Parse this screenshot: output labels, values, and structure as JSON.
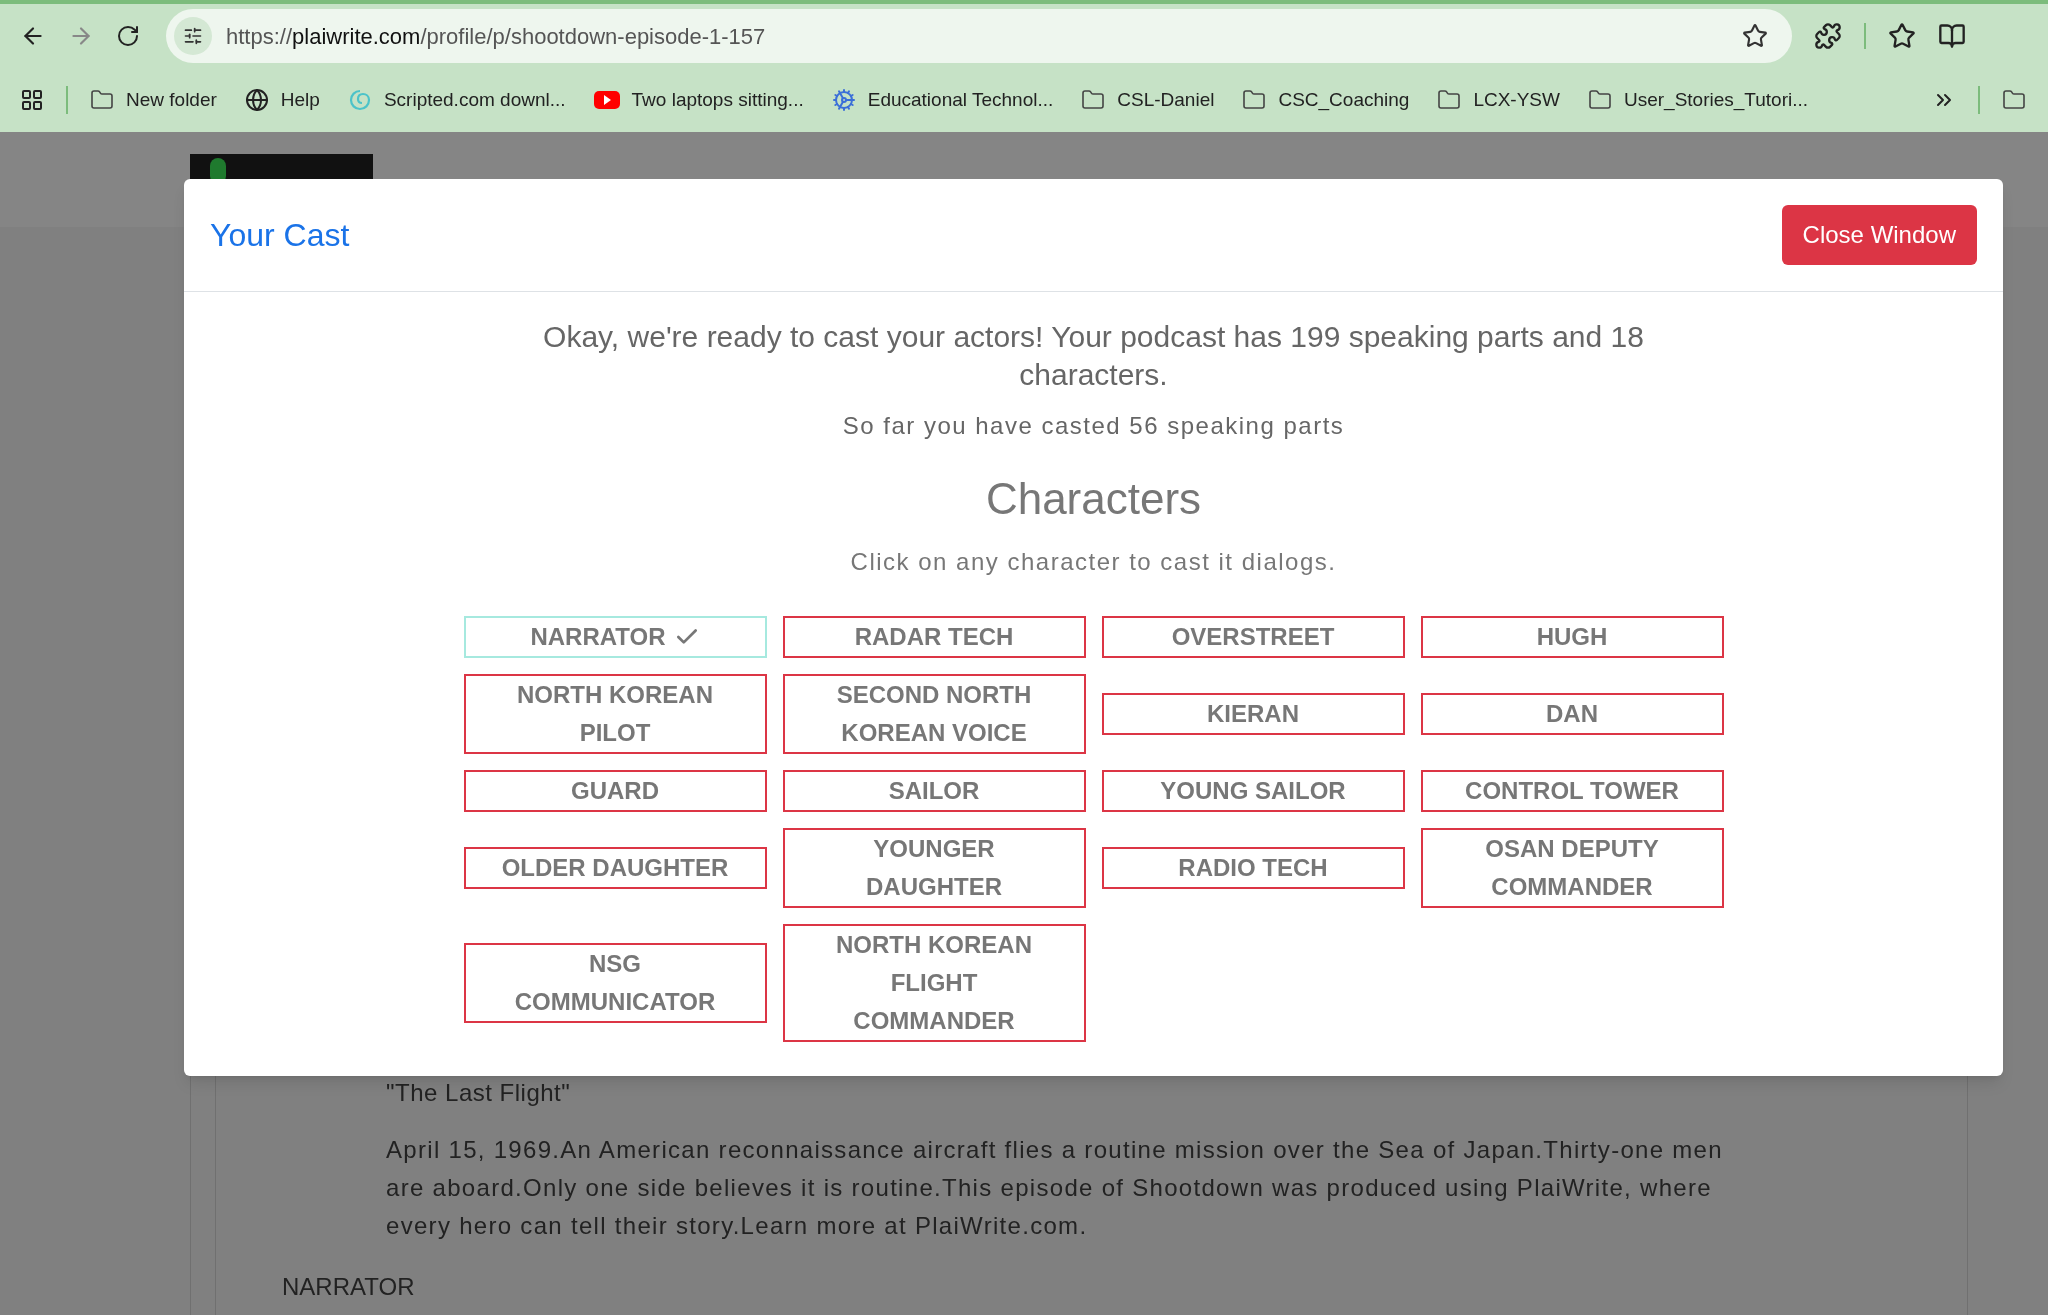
{
  "browser": {
    "url": {
      "scheme": "https://",
      "host": "plaiwrite.com",
      "path": "/profile/p/shootdown-episode-1-157"
    },
    "bookmarks": [
      {
        "kind": "folder",
        "label": "New folder"
      },
      {
        "kind": "globe",
        "label": "Help"
      },
      {
        "kind": "scripted",
        "label": "Scripted.com downl..."
      },
      {
        "kind": "video",
        "label": "Two laptops sitting..."
      },
      {
        "kind": "gear",
        "label": "Educational Technol..."
      },
      {
        "kind": "folder",
        "label": "CSL-Daniel"
      },
      {
        "kind": "folder",
        "label": "CSC_Coaching"
      },
      {
        "kind": "folder",
        "label": "LCX-YSW"
      },
      {
        "kind": "folder",
        "label": "User_Stories_Tutori..."
      }
    ],
    "overflow_bookmarks": [
      {
        "kind": "folder"
      }
    ]
  },
  "modal": {
    "title": "Your Cast",
    "close_button": "Close Window",
    "intro": "Okay, we're ready to cast your actors! Your podcast has 199 speaking parts and 18 characters.",
    "progress": "So far you have casted 56 speaking parts",
    "heading": "Characters",
    "hint": "Click on any character to cast it dialogs.",
    "characters": [
      {
        "label": "NARRATOR",
        "selected": true
      },
      {
        "label": "RADAR TECH",
        "selected": false
      },
      {
        "label": "OVERSTREET",
        "selected": false
      },
      {
        "label": "HUGH",
        "selected": false
      },
      {
        "label": "NORTH KOREAN PILOT",
        "selected": false
      },
      {
        "label": "SECOND NORTH KOREAN VOICE",
        "selected": false
      },
      {
        "label": "KIERAN",
        "selected": false
      },
      {
        "label": "DAN",
        "selected": false
      },
      {
        "label": "GUARD",
        "selected": false
      },
      {
        "label": "SAILOR",
        "selected": false
      },
      {
        "label": "YOUNG SAILOR",
        "selected": false
      },
      {
        "label": "CONTROL TOWER",
        "selected": false
      },
      {
        "label": "OLDER DAUGHTER",
        "selected": false
      },
      {
        "label": "YOUNGER DAUGHTER",
        "selected": false
      },
      {
        "label": "RADIO TECH",
        "selected": false
      },
      {
        "label": "OSAN DEPUTY COMMANDER",
        "selected": false
      },
      {
        "label": "NSG COMMUNICATOR",
        "selected": false
      },
      {
        "label": "NORTH KOREAN FLIGHT COMMANDER",
        "selected": false
      }
    ]
  },
  "episode": {
    "title": "\"The Last Flight\"",
    "description": "April 15, 1969.An American reconnaissance aircraft flies a routine mission over the Sea of Japan.Thirty-one men are aboard.Only one side believes it is routine.This episode of Shootdown was produced using PlaiWrite, where every hero can tell their story.Learn more at PlaiWrite.com.",
    "speaker": "NARRATOR"
  }
}
